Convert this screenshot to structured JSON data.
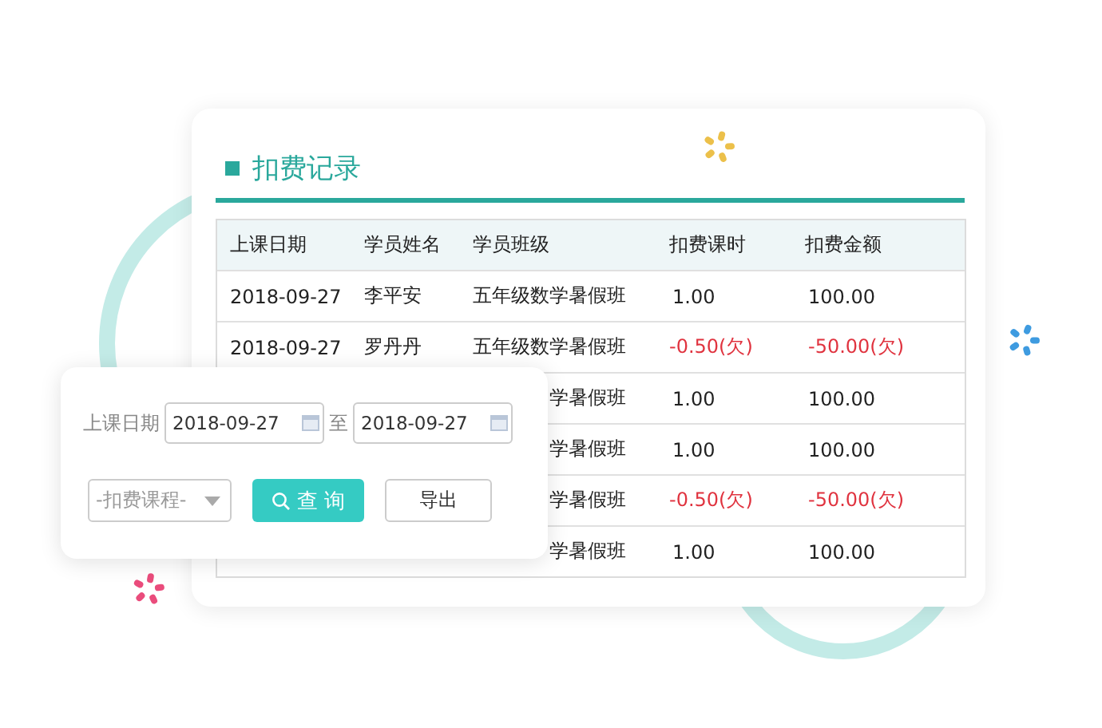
{
  "card": {
    "title": "扣费记录"
  },
  "table": {
    "columns": [
      "上课日期",
      "学员姓名",
      "学员班级",
      "扣费课时",
      "扣费金额"
    ],
    "rows": [
      {
        "date": "2018-09-27",
        "name": "李平安",
        "class": "五年级数学暑假班",
        "hours": "1.00",
        "amount": "100.00",
        "owed": false
      },
      {
        "date": "2018-09-27",
        "name": "罗丹丹",
        "class": "五年级数学暑假班",
        "hours": "-0.50(欠)",
        "amount": "-50.00(欠)",
        "owed": true
      },
      {
        "class": "学暑假班",
        "hours": "1.00",
        "amount": "100.00",
        "owed": false
      },
      {
        "class": "学暑假班",
        "hours": "1.00",
        "amount": "100.00",
        "owed": false
      },
      {
        "class": "学暑假班",
        "hours": "-0.50(欠)",
        "amount": "-50.00(欠)",
        "owed": true
      },
      {
        "class": "学暑假班",
        "hours": "1.00",
        "amount": "100.00",
        "owed": false
      }
    ]
  },
  "filter": {
    "date_label": "上课日期",
    "date_from": "2018-09-27",
    "separator": "至",
    "date_to": "2018-09-27",
    "course_select": {
      "placeholder": "-扣费课程-"
    },
    "search_button": "查 询",
    "export_button": "导出"
  }
}
